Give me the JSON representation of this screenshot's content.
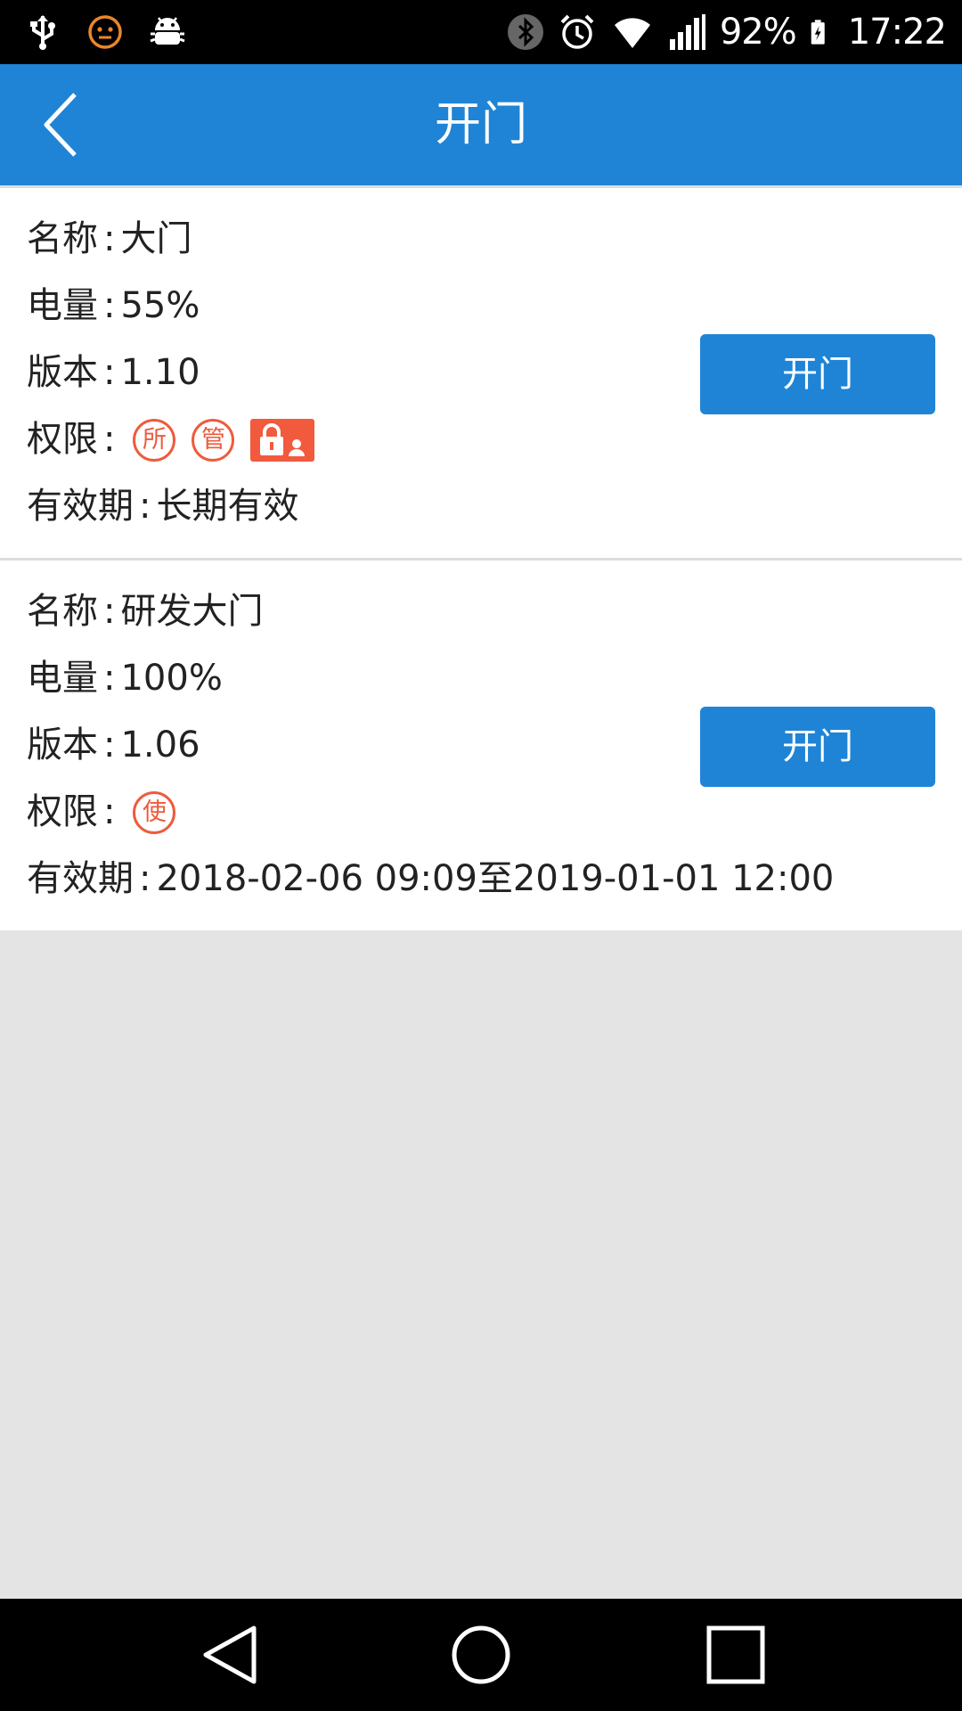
{
  "status_bar": {
    "battery_percent": "92%",
    "time": "17:22",
    "icons": [
      "usb-icon",
      "smiley-icon",
      "android-debug-icon",
      "bluetooth-icon",
      "alarm-icon",
      "wifi-icon",
      "signal-icon",
      "battery-charging-icon"
    ]
  },
  "header": {
    "title": "开门",
    "back_icon": "chevron-left-icon"
  },
  "locks": [
    {
      "name_label": "名称",
      "name": "大门",
      "battery_label": "电量",
      "battery": "55%",
      "version_label": "版本",
      "version": "1.10",
      "permission_label": "权限",
      "permissions": [
        "所",
        "管"
      ],
      "permission_icon": "lock-user-icon",
      "validity_label": "有效期",
      "validity": "长期有效",
      "open_label": "开门"
    },
    {
      "name_label": "名称",
      "name": "研发大门",
      "battery_label": "电量",
      "battery": "100%",
      "version_label": "版本",
      "version": "1.06",
      "permission_label": "权限",
      "permissions": [
        "使"
      ],
      "validity_label": "有效期",
      "validity": "2018-02-06 09:09至2019-01-01 12:00",
      "open_label": "开门"
    }
  ],
  "colors": {
    "primary": "#1f84d6",
    "badge": "#ee5b3c",
    "background": "#e4e4e4"
  },
  "nav_bar": {
    "icons": [
      "nav-back-icon",
      "nav-home-icon",
      "nav-recents-icon"
    ]
  }
}
